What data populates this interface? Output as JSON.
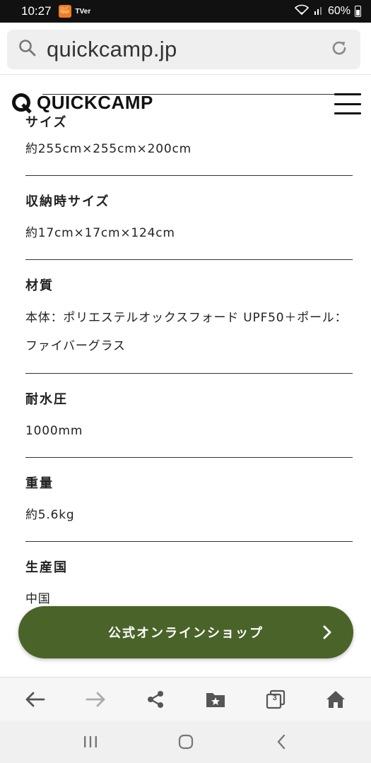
{
  "status_bar": {
    "time": "10:27",
    "app_badge_text": "ｽﾗﾝﾌﾟ TENT",
    "tver_text": "TVer",
    "battery_percent": "60%"
  },
  "browser": {
    "url": "quickcamp.jp"
  },
  "site": {
    "logo_text": "QUICKCAMP"
  },
  "specs": [
    {
      "label": "サイズ",
      "value": "約255cm×255cm×200cm"
    },
    {
      "label": "収納時サイズ",
      "value": "約17cm×17cm×124cm"
    },
    {
      "label": "材質",
      "value": "本体：ポリエステルオックスフォード UPF50＋ポール：ファイバーグラス"
    },
    {
      "label": "耐水圧",
      "value": "1000mm"
    },
    {
      "label": "重量",
      "value": "約5.6kg"
    },
    {
      "label": "生産国",
      "value": "中国"
    }
  ],
  "cta": {
    "label": "公式オンラインショップ"
  },
  "toolbar": {
    "tab_count": "3"
  },
  "colors": {
    "cta_green": "#4a6329",
    "status_bar": "#111111"
  }
}
